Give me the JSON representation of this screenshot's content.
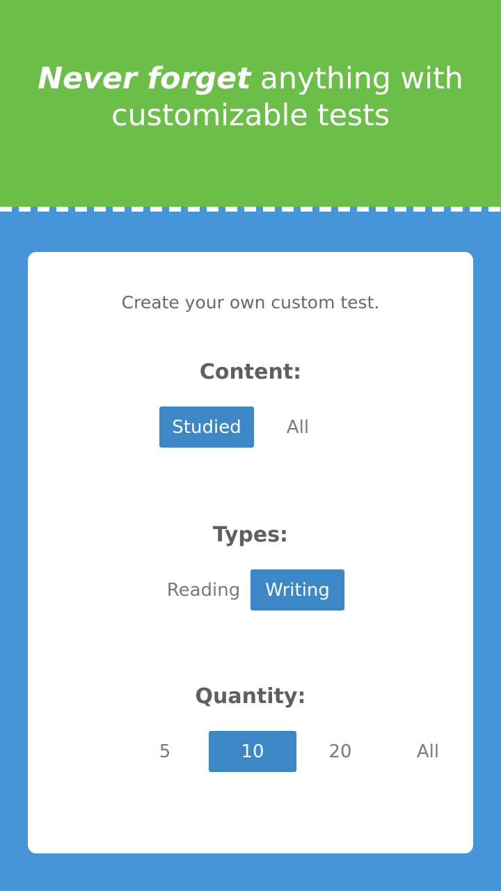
{
  "theme": {
    "green": "#6bbe47",
    "blue": "#4695d8",
    "accent_button": "#3c88c7",
    "card_background": "#ffffff",
    "text_gray": "#6a6a6a",
    "heading_gray": "#5f5f5f",
    "option_text_gray": "#7a7a7a",
    "selected_text": "#ffffff"
  },
  "hero": {
    "headline_emphasis": "Never forget",
    "headline_rest": " anything with customizable tests"
  },
  "card": {
    "subtitle": "Create your own custom test.",
    "sections": [
      {
        "id": "content",
        "title": "Content:",
        "options": [
          {
            "label": "Studied",
            "selected": true
          },
          {
            "label": "All",
            "selected": false
          }
        ]
      },
      {
        "id": "types",
        "title": "Types:",
        "options": [
          {
            "label": "Reading",
            "selected": false
          },
          {
            "label": "Writing",
            "selected": true
          }
        ]
      },
      {
        "id": "quantity",
        "title": "Quantity:",
        "options": [
          {
            "label": "5",
            "selected": false
          },
          {
            "label": "10",
            "selected": true
          },
          {
            "label": "20",
            "selected": false
          },
          {
            "label": "All",
            "selected": false
          }
        ]
      }
    ]
  }
}
